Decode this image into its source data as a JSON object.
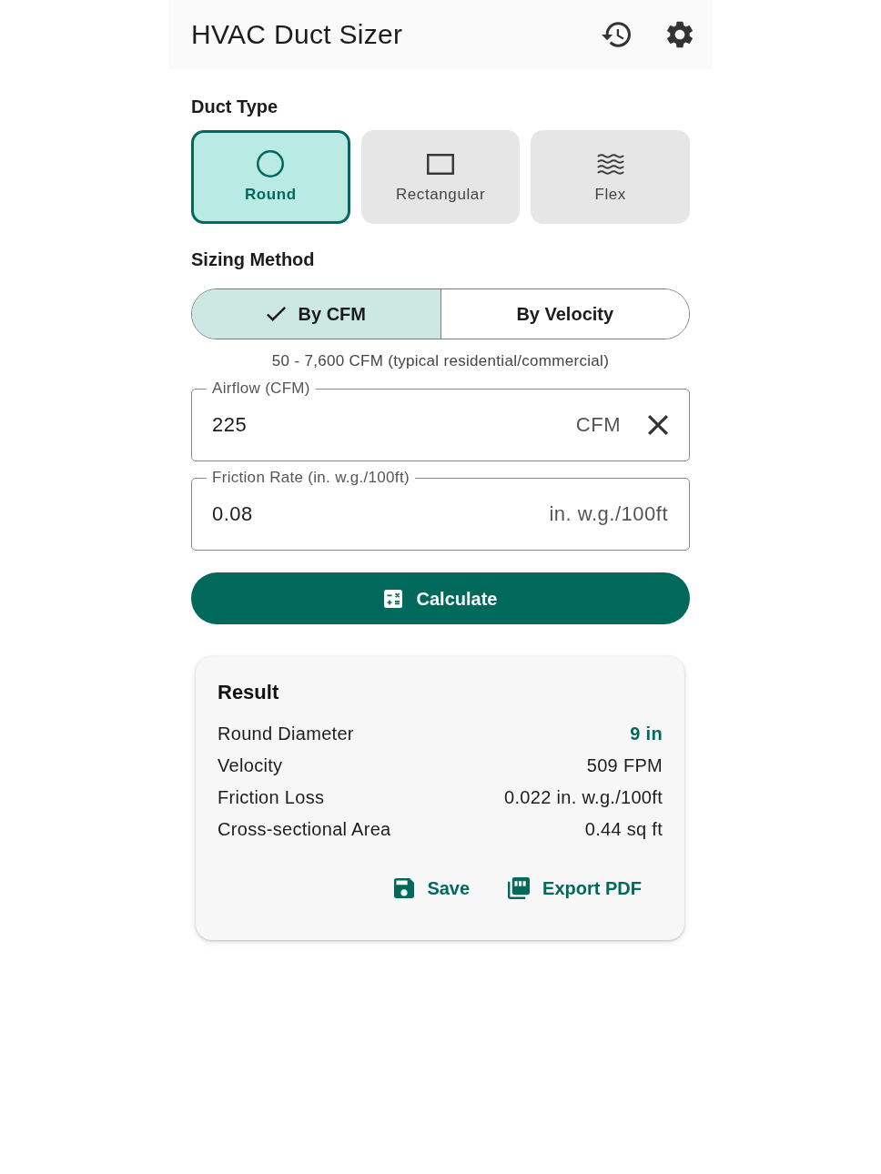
{
  "app_bar": {
    "title": "HVAC Duct Sizer"
  },
  "duct_type": {
    "label": "Duct Type",
    "options": [
      {
        "kind": "round",
        "label": "Round",
        "selected": true
      },
      {
        "kind": "rectangular",
        "label": "Rectangular",
        "selected": false
      },
      {
        "kind": "flex",
        "label": "Flex",
        "selected": false
      }
    ]
  },
  "sizing_method": {
    "label": "Sizing Method",
    "options": [
      {
        "label": "By CFM",
        "selected": true
      },
      {
        "label": "By Velocity",
        "selected": false
      }
    ],
    "hint": "50 - 7,600 CFM (typical residential/commercial)"
  },
  "fields": [
    {
      "label": "Airflow (CFM)",
      "value": "225",
      "suffix": "CFM",
      "clearable": true
    },
    {
      "label": "Friction Rate (in. w.g./100ft)",
      "value": "0.08",
      "suffix": "in. w.g./100ft",
      "clearable": false
    }
  ],
  "calculate_button": {
    "label": "Calculate"
  },
  "result": {
    "title": "Result",
    "rows": [
      {
        "label": "Round Diameter",
        "value": "9 in",
        "highlight": true
      },
      {
        "label": "Velocity",
        "value": "509 FPM",
        "highlight": false
      },
      {
        "label": "Friction Loss",
        "value": "0.022 in. w.g./100ft",
        "highlight": false
      },
      {
        "label": "Cross-sectional Area",
        "value": "0.44 sq ft",
        "highlight": false
      }
    ],
    "actions": [
      {
        "kind": "save",
        "label": "Save"
      },
      {
        "kind": "export_pdf",
        "label": "Export PDF"
      }
    ]
  }
}
